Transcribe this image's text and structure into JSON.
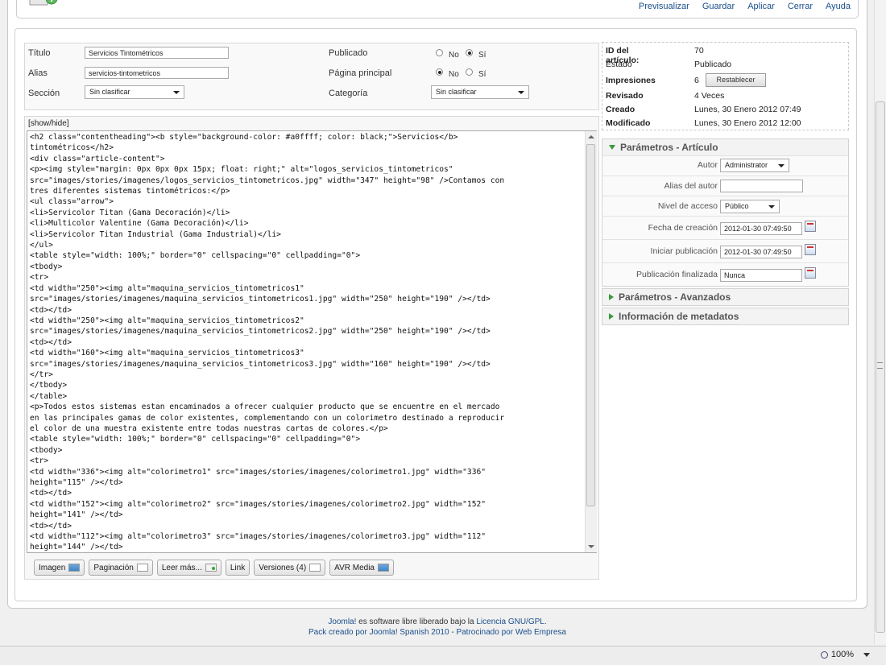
{
  "toolbar": {
    "items": [
      "Previsualizar",
      "Guardar",
      "Aplicar",
      "Cerrar",
      "Ayuda"
    ]
  },
  "details": {
    "titulo_label": "Título",
    "titulo_value": "Servicios Tintométricos",
    "alias_label": "Alias",
    "alias_value": "servicios-tintometricos",
    "seccion_label": "Sección",
    "seccion_value": "Sin clasificar",
    "publicado_label": "Publicado",
    "pagina_label": "Página principal",
    "categoria_label": "Categoría",
    "categoria_value": "Sin clasificar",
    "no_label": "No",
    "si_label": "Sí"
  },
  "editor": {
    "toggle_label": "[show/hide]",
    "content": "<h2 class=\"contentheading\"><b style=\"background-color: #a0ffff; color: black;\">Servicios</b>\ntintométricos</h2>\n<div class=\"article-content\">\n<p><img style=\"margin: 0px 0px 0px 15px; float: right;\" alt=\"logos_servicios_tintometricos\"\nsrc=\"images/stories/imagenes/logos_servicios_tintometricos.jpg\" width=\"347\" height=\"98\" />Contamos con\ntres diferentes sistemas tintométricos:</p>\n<ul class=\"arrow\">\n<li>Servicolor Titan (Gama Decoración)</li>\n<li>Multicolor Valentine (Gama Decoración)</li>\n<li>Servicolor Titan Industrial (Gama Industrial)</li>\n</ul>\n<table style=\"width: 100%;\" border=\"0\" cellspacing=\"0\" cellpadding=\"0\">\n<tbody>\n<tr>\n<td width=\"250\"><img alt=\"maquina_servicios_tintometricos1\"\nsrc=\"images/stories/imagenes/maquina_servicios_tintometricos1.jpg\" width=\"250\" height=\"190\" /></td>\n<td></td>\n<td width=\"250\"><img alt=\"maquina_servicios_tintometricos2\"\nsrc=\"images/stories/imagenes/maquina_servicios_tintometricos2.jpg\" width=\"250\" height=\"190\" /></td>\n<td></td>\n<td width=\"160\"><img alt=\"maquina_servicios_tintometricos3\"\nsrc=\"images/stories/imagenes/maquina_servicios_tintometricos3.jpg\" width=\"160\" height=\"190\" /></td>\n</tr>\n</tbody>\n</table>\n<p>Todos estos sistemas estan encaminados a ofrecer cualquier producto que se encuentre en el mercado\nen las principales gamas de color existentes, complementando con un colorimetro destinado a reproducir\nel color de una muestra existente entre todas nuestras cartas de colores.</p>\n<table style=\"width: 100%;\" border=\"0\" cellspacing=\"0\" cellpadding=\"0\">\n<tbody>\n<tr>\n<td width=\"336\"><img alt=\"colorimetro1\" src=\"images/stories/imagenes/colorimetro1.jpg\" width=\"336\"\nheight=\"115\" /></td>\n<td></td>\n<td width=\"152\"><img alt=\"colorimetro2\" src=\"images/stories/imagenes/colorimetro2.jpg\" width=\"152\"\nheight=\"141\" /></td>\n<td></td>\n<td width=\"112\"><img alt=\"colorimetro3\" src=\"images/stories/imagenes/colorimetro3.jpg\" width=\"112\"\nheight=\"144\" /></td>",
    "buttons": {
      "imagen": "Imagen",
      "paginacion": "Paginación",
      "leer_mas": "Leer más...",
      "link": "Link",
      "versiones": "Versiones (4)",
      "avr_media": "AVR Media"
    }
  },
  "info": {
    "id_label": "ID del artículo:",
    "id_value": "70",
    "estado_label": "Estado",
    "estado_value": "Publicado",
    "impresiones_label": "Impresiones",
    "impresiones_value": "6",
    "restablecer_label": "Restablecer",
    "revisado_label": "Revisado",
    "revisado_value": "4 Veces",
    "creado_label": "Creado",
    "creado_value": "Lunes, 30 Enero 2012 07:49",
    "modificado_label": "Modificado",
    "modificado_value": "Lunes, 30 Enero 2012 12:00"
  },
  "params": {
    "title": "Parámetros - Artículo",
    "autor_label": "Autor",
    "autor_value": "Administrator",
    "alias_autor_label": "Alias del autor",
    "alias_autor_value": "",
    "nivel_label": "Nivel de acceso",
    "nivel_value": "Público",
    "fecha_creacion_label": "Fecha de creación",
    "fecha_creacion_value": "2012-01-30 07:49:50",
    "iniciar_label": "Iniciar publicación",
    "iniciar_value": "2012-01-30 07:49:50",
    "finalizada_label": "Publicación finalizada",
    "finalizada_value": "Nunca"
  },
  "panels": {
    "avanzados_title": "Parámetros - Avanzados",
    "metadatos_title": "Información de metadatos"
  },
  "footer": {
    "line1_joomla": "Joomla!",
    "line1_text": " es software libre liberado bajo la ",
    "line1_license": "Licencia GNU/GPL.",
    "line2_pack": "Pack creado por Joomla! Spanish 2010",
    "line2_sep": " - ",
    "line2_sponsor": "Patrocinado por Web Empresa"
  },
  "status": {
    "zoom": "100%"
  },
  "colors": {
    "link": "#1a4f8b",
    "panel_header_text": "#555555",
    "accent_green": "#3a9a3a"
  }
}
